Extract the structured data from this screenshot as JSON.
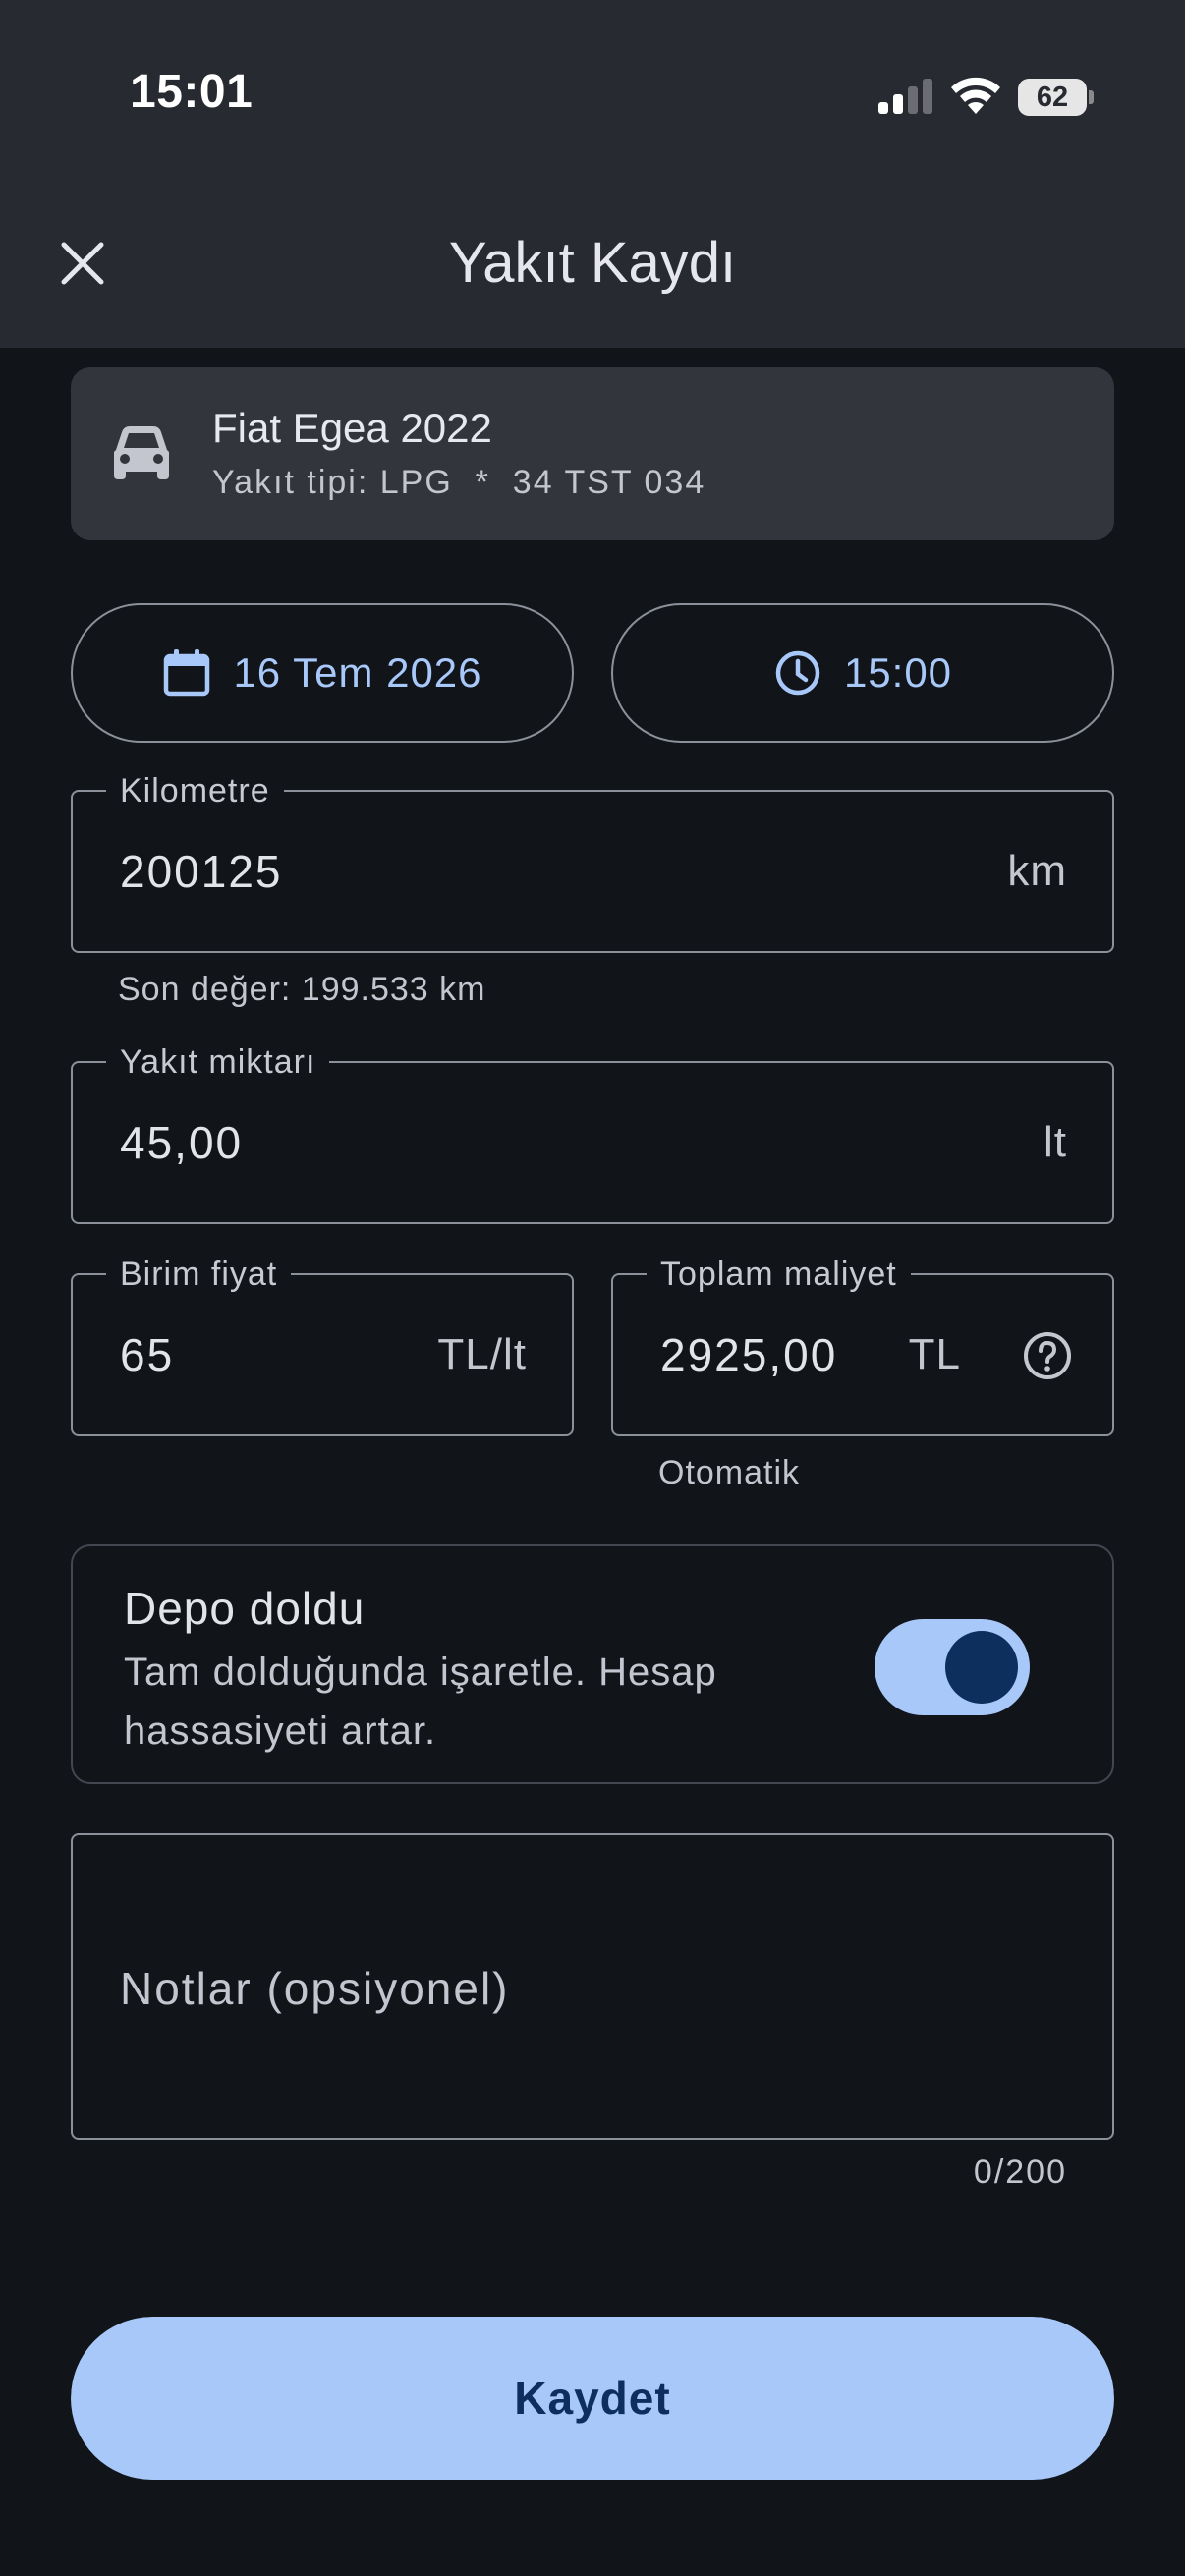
{
  "status_bar": {
    "time": "15:01",
    "battery_level": "62",
    "signal_icon": "cellular-signal-icon",
    "wifi_icon": "wifi-icon"
  },
  "header": {
    "title": "Yakıt Kaydı",
    "close_icon": "close-icon"
  },
  "vehicle": {
    "name": "Fiat Egea 2022",
    "subtitle": "Yakıt tipi: LPG  *  34 TST 034",
    "icon": "car-icon"
  },
  "date_button": {
    "label": "16 Tem 2026",
    "icon": "calendar-icon"
  },
  "time_button": {
    "label": "15:00",
    "icon": "clock-icon"
  },
  "odometer": {
    "label": "Kilometre",
    "value": "200125",
    "unit": "km",
    "helper": "Son değer: 199.533 km"
  },
  "fuel_amount": {
    "label": "Yakıt miktarı",
    "value": "45,00",
    "unit": "lt"
  },
  "unit_price": {
    "label": "Birim fiyat",
    "value": "65",
    "unit": "TL/lt"
  },
  "total_cost": {
    "label": "Toplam maliyet",
    "value": "2925,00",
    "unit": "TL",
    "helper": "Otomatik",
    "icon": "help-circle-icon"
  },
  "full_tank": {
    "title": "Depo doldu",
    "description": "Tam dolduğunda işaretle. Hesap hassasiyeti artar.",
    "enabled": true
  },
  "notes": {
    "placeholder": "Notlar (opsiyonel)",
    "counter": "0/200"
  },
  "save_button": {
    "label": "Kaydet"
  },
  "colors": {
    "background": "#111418",
    "header": "#282a32",
    "accent": "#a8c8fa",
    "on_accent": "#0d2f5e",
    "outline": "#8c9099"
  }
}
